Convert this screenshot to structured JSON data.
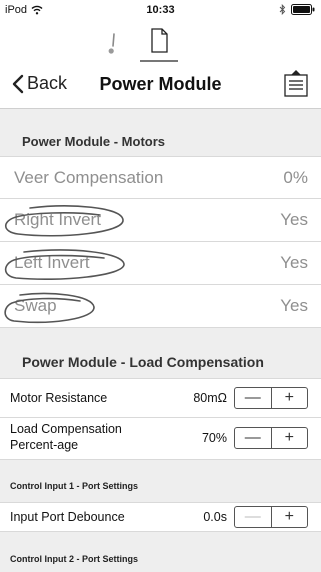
{
  "status_bar": {
    "carrier": "iPod",
    "time": "10:33"
  },
  "icons": {
    "wifi": "wifi-icon",
    "bluetooth": "bluetooth-icon",
    "battery": "battery-icon",
    "warning_tab": "warning-icon",
    "document_tab": "document-icon",
    "share": "share-icon"
  },
  "nav": {
    "back_label": "Back",
    "title": "Power Module"
  },
  "motors_section": {
    "header": "Power Module - Motors",
    "rows": [
      {
        "label": "Veer Compensation",
        "value": "0%"
      },
      {
        "label": "Right Invert",
        "value": "Yes"
      },
      {
        "label": "Left Invert",
        "value": "Yes"
      },
      {
        "label": "Swap",
        "value": "Yes"
      }
    ]
  },
  "load_section": {
    "header": "Power Module - Load Compensation",
    "rows": [
      {
        "label": "Motor Resistance",
        "value": "80mΩ"
      },
      {
        "label": "Load Compensation Percent-age",
        "value": "70%"
      }
    ]
  },
  "control_input_1": {
    "header": "Control Input 1 - Port Settings",
    "rows": [
      {
        "label": "Input Port Debounce",
        "value": "0.0s"
      }
    ]
  },
  "control_input_2": {
    "header": "Control Input 2 - Port Settings"
  },
  "stepper": {
    "minus": "—",
    "plus": "+"
  },
  "colors": {
    "section_bg": "#eeeeee",
    "muted_text": "#8f8f8f",
    "divider": "#d9d9d9",
    "scribble": "#555555"
  }
}
